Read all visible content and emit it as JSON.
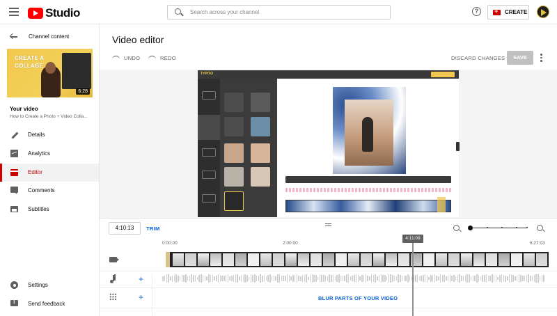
{
  "header": {
    "app_name": "Studio",
    "search_placeholder": "Search across your channel",
    "create_label": "CREATE"
  },
  "sidebar": {
    "back_label": "Channel content",
    "thumbnail": {
      "overlay_text_line1": "CREATE A",
      "overlay_text_line2": "COLLAGE",
      "duration": "6:28"
    },
    "your_video_label": "Your video",
    "video_title": "How to Create a Photo + Video Colla...",
    "items": [
      {
        "label": "Details",
        "icon": "pencil-icon",
        "active": false
      },
      {
        "label": "Analytics",
        "icon": "analytics-icon",
        "active": false
      },
      {
        "label": "Editor",
        "icon": "editor-clapper-icon",
        "active": true
      },
      {
        "label": "Comments",
        "icon": "comments-icon",
        "active": false
      },
      {
        "label": "Subtitles",
        "icon": "subtitles-icon",
        "active": false
      }
    ],
    "bottom_items": [
      {
        "label": "Settings",
        "icon": "gear-icon"
      },
      {
        "label": "Send feedback",
        "icon": "feedback-icon"
      }
    ]
  },
  "editor": {
    "title": "Video editor",
    "undo_label": "UNDO",
    "redo_label": "REDO",
    "discard_label": "DISCARD CHANGES",
    "save_label": "SAVE",
    "preview_app_logo": "TYPITO"
  },
  "timeline": {
    "current_time": "4:10:13",
    "trim_label": "TRIM",
    "ruler": [
      "0:00:00",
      "2:00:00",
      "6:27:03"
    ],
    "playhead_time": "4:11:09",
    "blur_label": "BLUR PARTS OF YOUR VIDEO",
    "add_icon": "+"
  },
  "colors": {
    "accent": "#065fd4",
    "brand_red": "#ff0000",
    "active_red": "#cc0000",
    "save_disabled": "#c0c0c0"
  }
}
